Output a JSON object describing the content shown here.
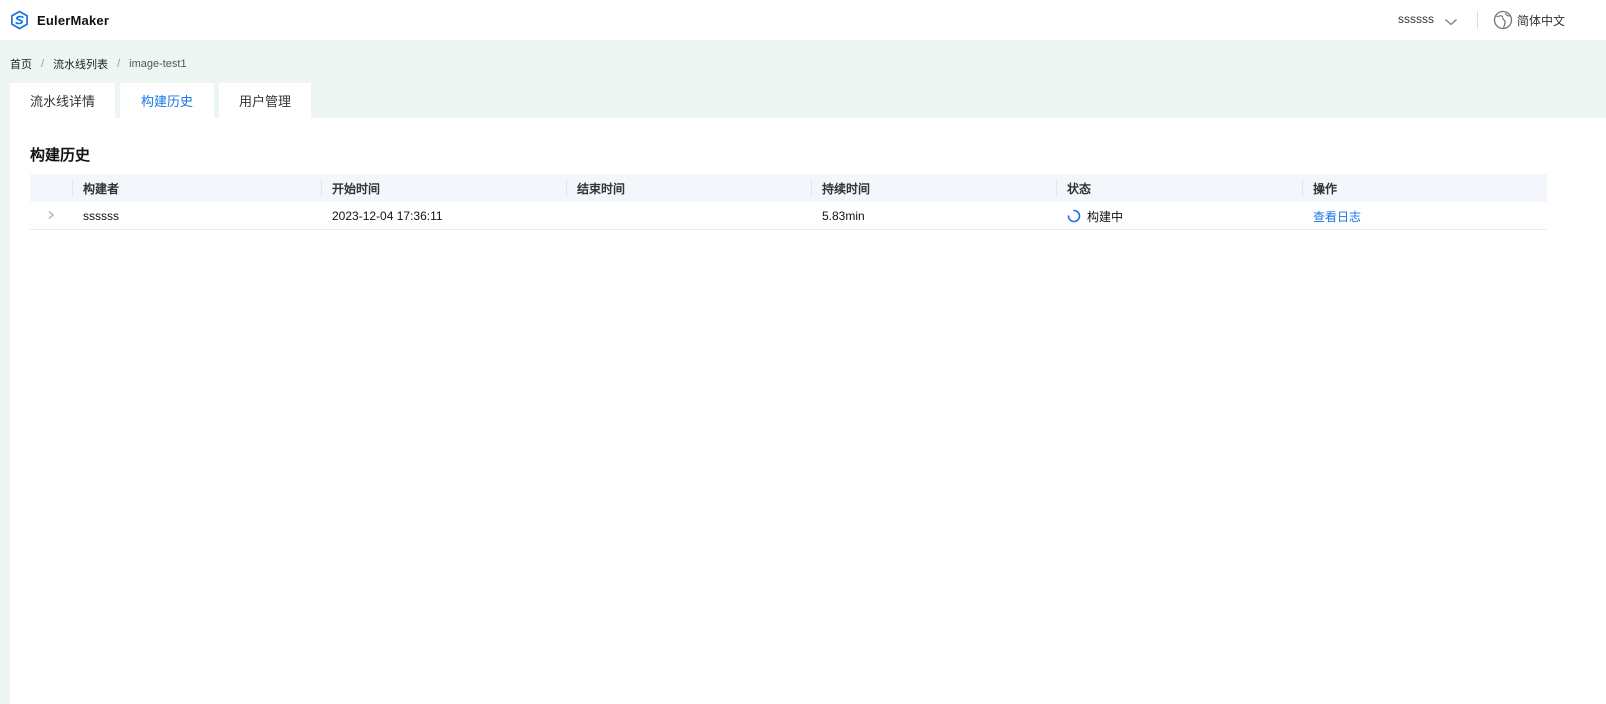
{
  "app": {
    "logo_text": "EulerMaker",
    "brand_color": "#1a73e8"
  },
  "header": {
    "username": "ssssss",
    "language": "简体中文"
  },
  "breadcrumb": {
    "home": "首页",
    "pipelines": "流水线列表",
    "current": "image-test1"
  },
  "tabs": [
    {
      "label": "流水线详情",
      "active": false
    },
    {
      "label": "构建历史",
      "active": true
    },
    {
      "label": "用户管理",
      "active": false
    }
  ],
  "panel": {
    "title": "构建历史"
  },
  "table": {
    "columns": [
      "构建者",
      "开始时间",
      "结束时间",
      "持续时间",
      "状态",
      "操作"
    ],
    "rows": [
      {
        "builder": "ssssss",
        "start_time": "2023-12-04 17:36:11",
        "end_time": "",
        "duration": "5.83min",
        "status": "构建中",
        "action": "查看日志"
      }
    ]
  },
  "icons": {
    "logo": "eulermaker-logo-icon",
    "user_dropdown": "chevron-down-icon",
    "language": "globe-icon",
    "row_expand": "chevron-right-icon",
    "status": "loading-spinner-icon"
  }
}
